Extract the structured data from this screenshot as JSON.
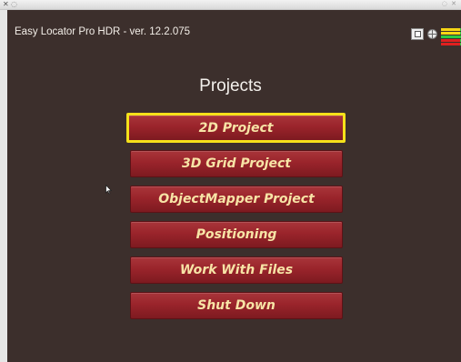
{
  "window": {
    "close_glyph": "✕",
    "minimize_glyph": "◌",
    "right_glyphs": "◌ ✕"
  },
  "app": {
    "title": "Easy Locator Pro HDR - ver. 12.2.075"
  },
  "status": {
    "icons": [
      "tablet-icon",
      "globe-icon",
      "signal-meter-icon"
    ],
    "signal_colors": {
      "green": "#2ecc40",
      "yellow": "#f6d615",
      "red": "#e02020"
    }
  },
  "main": {
    "heading": "Projects",
    "buttons": [
      {
        "label": "2D Project",
        "selected": true
      },
      {
        "label": "3D Grid Project",
        "selected": false
      },
      {
        "label": "ObjectMapper Project",
        "selected": false
      },
      {
        "label": "Positioning",
        "selected": false
      },
      {
        "label": "Work With Files",
        "selected": false
      },
      {
        "label": "Shut Down",
        "selected": false
      }
    ]
  },
  "colors": {
    "background": "#3c2f2c",
    "button_fill": "#9a242b",
    "button_text": "#f7e4a6",
    "selection_border": "#f5e11a"
  }
}
